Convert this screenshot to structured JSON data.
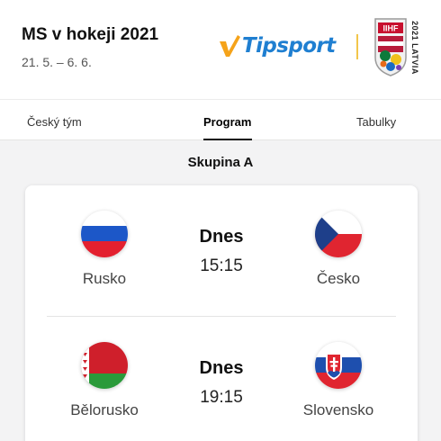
{
  "header": {
    "title": "MS v hokeji 2021",
    "dates": "21. 5. – 6. 6.",
    "sponsor": "Tipsport",
    "event_badge": "IIHF",
    "event_side_text": "2021 LATVIA",
    "sponsor_color": "#1f7fd1",
    "sponsor_accent": "#f5a31a"
  },
  "tabs": [
    {
      "label": "Český tým",
      "active": false
    },
    {
      "label": "Program",
      "active": true
    },
    {
      "label": "Tabulky",
      "active": false
    }
  ],
  "group": {
    "title": "Skupina A"
  },
  "matches": [
    {
      "home": {
        "name": "Rusko",
        "flag_icon": "russia-flag-icon"
      },
      "away": {
        "name": "Česko",
        "flag_icon": "czech-flag-icon"
      },
      "day": "Dnes",
      "time": "15:15"
    },
    {
      "home": {
        "name": "Bělorusko",
        "flag_icon": "belarus-flag-icon"
      },
      "away": {
        "name": "Slovensko",
        "flag_icon": "slovakia-flag-icon"
      },
      "day": "Dnes",
      "time": "19:15"
    }
  ]
}
